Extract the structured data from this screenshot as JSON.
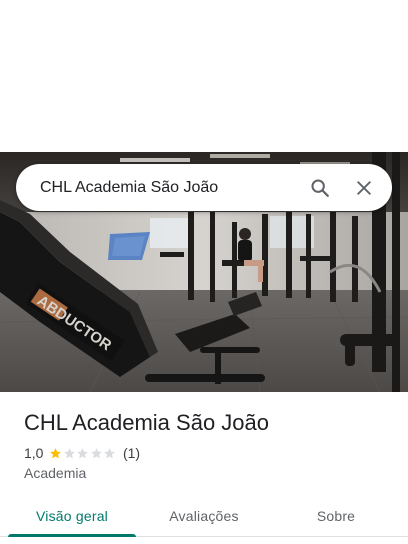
{
  "search": {
    "value": "CHL Academia São João"
  },
  "hero": {
    "machine_logo_text": "ABDUCTOR"
  },
  "place": {
    "title": "CHL Academia São João",
    "rating": "1,0",
    "rating_value": 1.0,
    "stars_max": 5,
    "review_count": "(1)",
    "category": "Academia"
  },
  "tabs": [
    {
      "label": "Visão geral",
      "active": true
    },
    {
      "label": "Avaliações",
      "active": false
    },
    {
      "label": "Sobre",
      "active": false
    }
  ],
  "icons": {
    "search": "search-icon",
    "close": "close-icon",
    "star": "star-icon"
  },
  "colors": {
    "accent": "#00796b",
    "star_filled": "#fbbc04",
    "star_empty": "#dadce0"
  }
}
